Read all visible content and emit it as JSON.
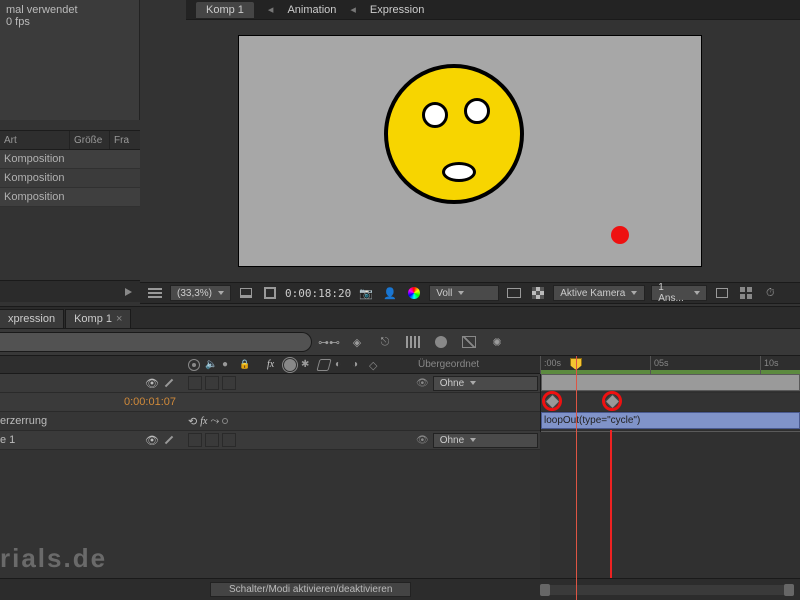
{
  "breadcrumb": {
    "comp": "Komp 1",
    "seg2": "Animation",
    "seg3": "Expression"
  },
  "project": {
    "info_line1": "mal verwendet",
    "info_line2": "0 fps",
    "cols": {
      "art": "Art",
      "groesse": "Größe",
      "fra": "Fra"
    },
    "rows": [
      "Komposition",
      "Komposition",
      "Komposition"
    ]
  },
  "preview_toolbar": {
    "zoom": "(33,3%)",
    "timecode": "0:00:18:20",
    "resolution": "Voll",
    "view": "Aktive Kamera",
    "views": "1 Ans..."
  },
  "timeline": {
    "tabs": {
      "t1": "xpression",
      "t2": "Komp 1"
    },
    "parent_header": "Übergeordnet",
    "parent_value": "Ohne",
    "ruler": {
      "t0": ":00s",
      "t5": "05s",
      "t10": "10s"
    },
    "prop_timecode": "0:00:01:07",
    "layer1_name": "erzerrung",
    "layer2_name": "e 1",
    "expression": "loopOut(type=\"cycle\")",
    "bottom_toggle": "Schalter/Modi aktivieren/deaktivieren"
  },
  "watermark": "rials.de"
}
